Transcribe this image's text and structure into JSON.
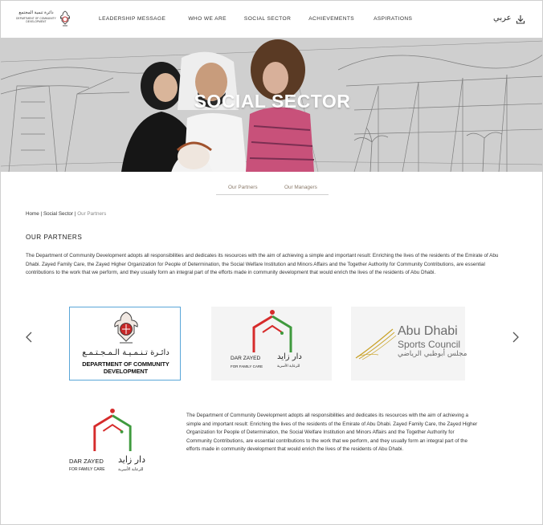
{
  "header": {
    "logo": {
      "arabic_text": "دائرة تنمية المجتمع",
      "english_text": "DEPARTMENT OF COMMUNITY DEVELOPMENT",
      "emblem_icon": "falcon-emblem-icon"
    },
    "nav": [
      {
        "label": "LEADERSHIP MESSAGE"
      },
      {
        "label": "WHO WE ARE"
      },
      {
        "label": "SOCIAL SECTOR"
      },
      {
        "label": "ACHIEVEMENTS"
      },
      {
        "label": "ASPIRATIONS"
      }
    ],
    "language_toggle": "عربي",
    "download_icon": "download-icon"
  },
  "hero": {
    "title": "SOCIAL SECTOR"
  },
  "subtabs": [
    {
      "label": "Our Partners"
    },
    {
      "label": "Our Managers"
    }
  ],
  "breadcrumb": {
    "home": "Home",
    "sep1": " | ",
    "section": "Social Sector",
    "sep2": " | ",
    "current": "Our Partners"
  },
  "partners": {
    "title": "OUR PARTNERS",
    "intro": "The Department of Community Development adopts all responsibilities and dedicates its resources with the aim of achieving a simple and important result: Enriching the lives of the residents of the Emirate of Abu Dhabi. Zayed Family Care, the Zayed Higher Organization for People of Determination, the Social Welfare Institution and Minors Affairs and the Together Authority for Community Contributions, are essential contributions to the work that we perform, and they usually form an integral part of the efforts made in community development that would enrich the lives of the residents of Abu Dhabi.",
    "carousel": {
      "prev_icon": "chevron-left-icon",
      "next_icon": "chevron-right-icon",
      "items": [
        {
          "arabic": "دائـرة تـنـمـيـة الـمـجـتـمـع",
          "english_line1": "DEPARTMENT OF COMMUNITY",
          "english_line2": "DEVELOPMENT",
          "selected": true
        },
        {
          "english": "DAR ZAYED",
          "english_sub": "FOR FAMILY CARE",
          "arabic": "دار زايد",
          "arabic_sub": "للرعاية الأسرية"
        },
        {
          "line1": "Abu Dhabi",
          "line2": "Sports Council",
          "arabic": "مجلس أبوظبي الرياضي"
        }
      ]
    },
    "detail": {
      "logo": {
        "english": "DAR ZAYED",
        "english_sub": "FOR FAMILY CARE",
        "arabic": "دار زايد",
        "arabic_sub": "للرعاية الأسرية"
      },
      "text": "The Department of Community Development adopts all responsibilities and dedicates its resources with the aim of achieving a simple and important result: Enriching the lives of the residents of the Emirate of Abu Dhabi. Zayed Family Care, the Zayed Higher Organization for People of Determination, the Social Welfare Institution and Minors Affairs and the Together Authority for Community Contributions, are essential contributions to the work that we perform, and they usually form an integral part of the efforts made in community development that would enrich the lives of the residents of Abu Dhabi."
    }
  },
  "colors": {
    "dar_zayed_red": "#d62b2b",
    "dar_zayed_green": "#3f9a3e",
    "gold": "#c9a227",
    "selected_border": "#5aa6d8",
    "tab_text": "#8a7a6a"
  }
}
